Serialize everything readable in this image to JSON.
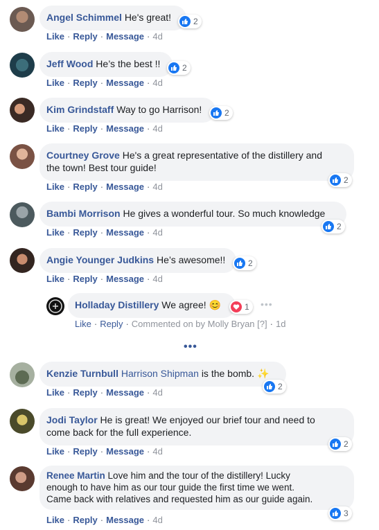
{
  "comments": [
    {
      "author": "Angel Schimmel",
      "text": "He's great!",
      "reactions": "2"
    },
    {
      "author": "Jeff Wood",
      "text": "He’s the best !!",
      "reactions": "2"
    },
    {
      "author": "Kim Grindstaff",
      "text": "Way to go Harrison!",
      "reactions": "2"
    },
    {
      "author": "Courtney Grove",
      "text_line1": "He's a great representative of the distillery and",
      "text_line2": "the town! Best tour guide!",
      "reactions": "2"
    },
    {
      "author": "Bambi Morrison",
      "text": "He gives a wonderful tour. So much knowledge",
      "reactions": "2"
    },
    {
      "author": "Angie Younger Judkins",
      "text": "He’s awesome!!",
      "reactions": "2"
    },
    {
      "author": "Kenzie Turnbull",
      "mention": "Harrison Shipman",
      "text": "is the bomb.",
      "emoji": "✨",
      "reactions": "2"
    },
    {
      "author": "Jodi Taylor",
      "text_line1": "He is great! We enjoyed our brief tour and need to",
      "text_line2": "come back for the full experience.",
      "reactions": "2"
    },
    {
      "author": "Renee Martin",
      "text_line1": "Love him and the tour of the distillery! Lucky",
      "text_line2": "enough to have him as our tour guide the first time we went.",
      "text_line3": "Came back with relatives and requested him as our guide again.",
      "reactions": "3"
    }
  ],
  "reply": {
    "author": "Holladay Distillery",
    "text": "We agree!",
    "emoji": "😊",
    "reactions": "1",
    "commented_on": "Commented on by Molly Bryan",
    "help_mark": "[?]",
    "time": "1d"
  },
  "actions": {
    "like": "Like",
    "reply": "Reply",
    "message": "Message",
    "time": "4d",
    "sep": "·"
  },
  "more_replies": "•••",
  "menu_dots": "•••"
}
